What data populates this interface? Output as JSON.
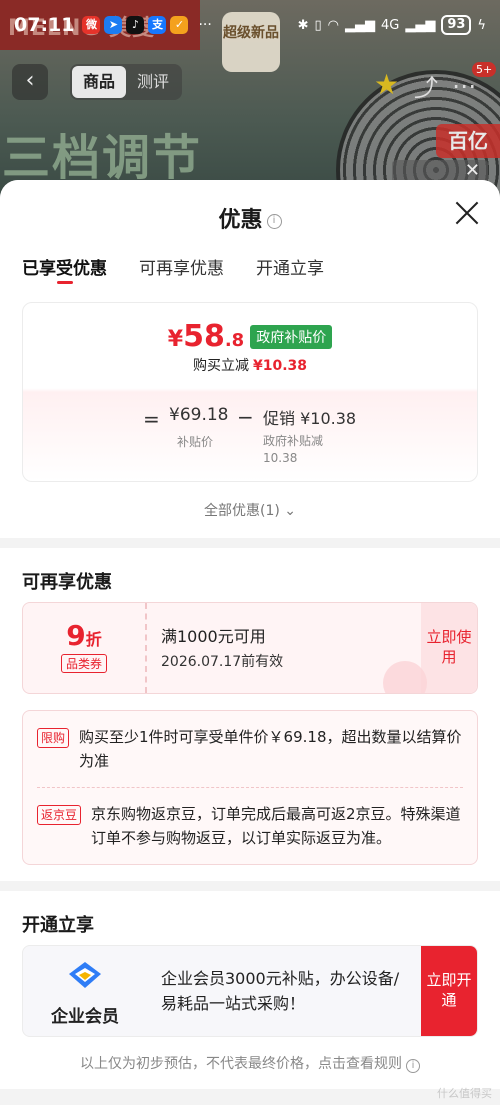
{
  "status_bar": {
    "time": "07:11",
    "battery": "93",
    "network": "4G"
  },
  "background": {
    "brand_text": "MELNG 美菱",
    "badge_new": "超级新品",
    "tabs": [
      "商品",
      "测评"
    ],
    "active_tab": "商品",
    "caption": "三档调节",
    "notification_count": "5+",
    "promo_tag": "百亿"
  },
  "sheet": {
    "title": "优惠",
    "tabs": [
      "已享受优惠",
      "可再享优惠",
      "开通立享"
    ],
    "active_tab": "已享受优惠",
    "price": {
      "currency": "¥",
      "integer": "58",
      "decimal": ".8",
      "gov_tag": "政府补贴价",
      "discount_label": "购买立减",
      "discount_value": "¥10.38",
      "equals": "=",
      "subsidy_price": "¥69.18",
      "subsidy_label": "补贴价",
      "minus": "−",
      "promo": "促销 ¥10.38",
      "promo_sub": "政府补贴减 10.38"
    },
    "all_discounts": "全部优惠(1) ⌄",
    "more_section": {
      "title": "可再享优惠",
      "coupon": {
        "discount_num": "9",
        "discount_unit": "折",
        "category": "品类券",
        "condition": "满1000元可用",
        "expiry": "2026.07.17前有效",
        "button": "立即使用"
      },
      "notes": [
        {
          "tag": "限购",
          "text": "购买至少1件时可享受单件价￥69.18，超出数量以结算价为准"
        },
        {
          "tag": "返京豆",
          "text": "京东购物返京豆，订单完成后最高可返2京豆。特殊渠道订单不参与购物返豆，以订单实际返豆为准。"
        }
      ]
    },
    "open_section": {
      "title": "开通立享",
      "vip_name": "企业会员",
      "vip_desc": "企业会员3000元补贴，办公设备/易耗品一站式采购！",
      "button": "立即开通"
    },
    "footer": "以上仅为初步预估，不代表最终价格，点击查看规则",
    "watermark": "什么值得买"
  },
  "colors": {
    "accent_red": "#e8232f",
    "gov_green": "#2ea44f"
  }
}
